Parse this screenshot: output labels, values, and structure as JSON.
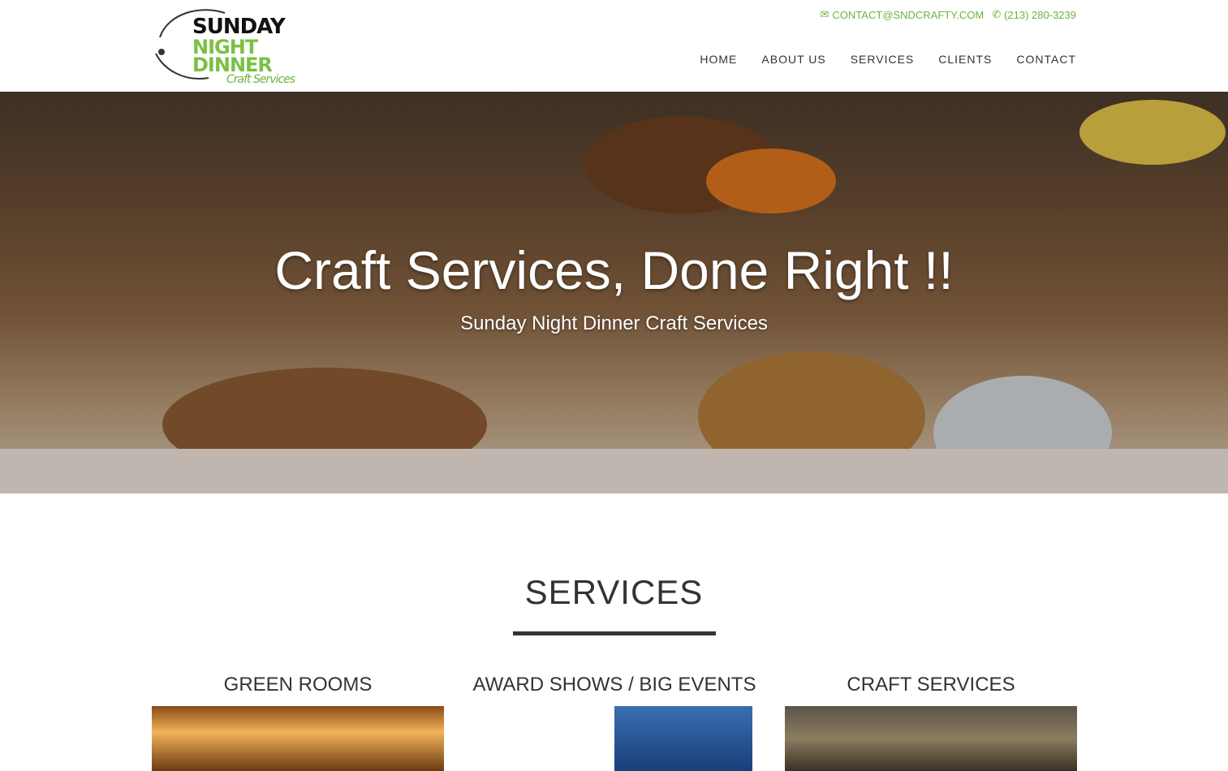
{
  "header": {
    "contact_email": "CONTACT@SNDCRAFTY.COM",
    "contact_phone": "(213) 280-3239",
    "brand_color": "#6cb33f",
    "logo": {
      "line1": "SUNDAY",
      "line2": "NIGHT",
      "line3": "DINNER",
      "line4": "Craft Services"
    }
  },
  "nav": {
    "items": [
      {
        "label": "HOME"
      },
      {
        "label": "ABOUT US"
      },
      {
        "label": "SERVICES"
      },
      {
        "label": "CLIENTS"
      },
      {
        "label": "CONTACT"
      }
    ]
  },
  "hero": {
    "title": "Craft Services, Done Right !!",
    "subtitle": "Sunday Night Dinner Craft Services"
  },
  "services": {
    "heading": "SERVICES",
    "cards": [
      {
        "title": "GREEN ROOMS"
      },
      {
        "title": "AWARD SHOWS / BIG EVENTS"
      },
      {
        "title": "CRAFT SERVICES"
      }
    ]
  }
}
